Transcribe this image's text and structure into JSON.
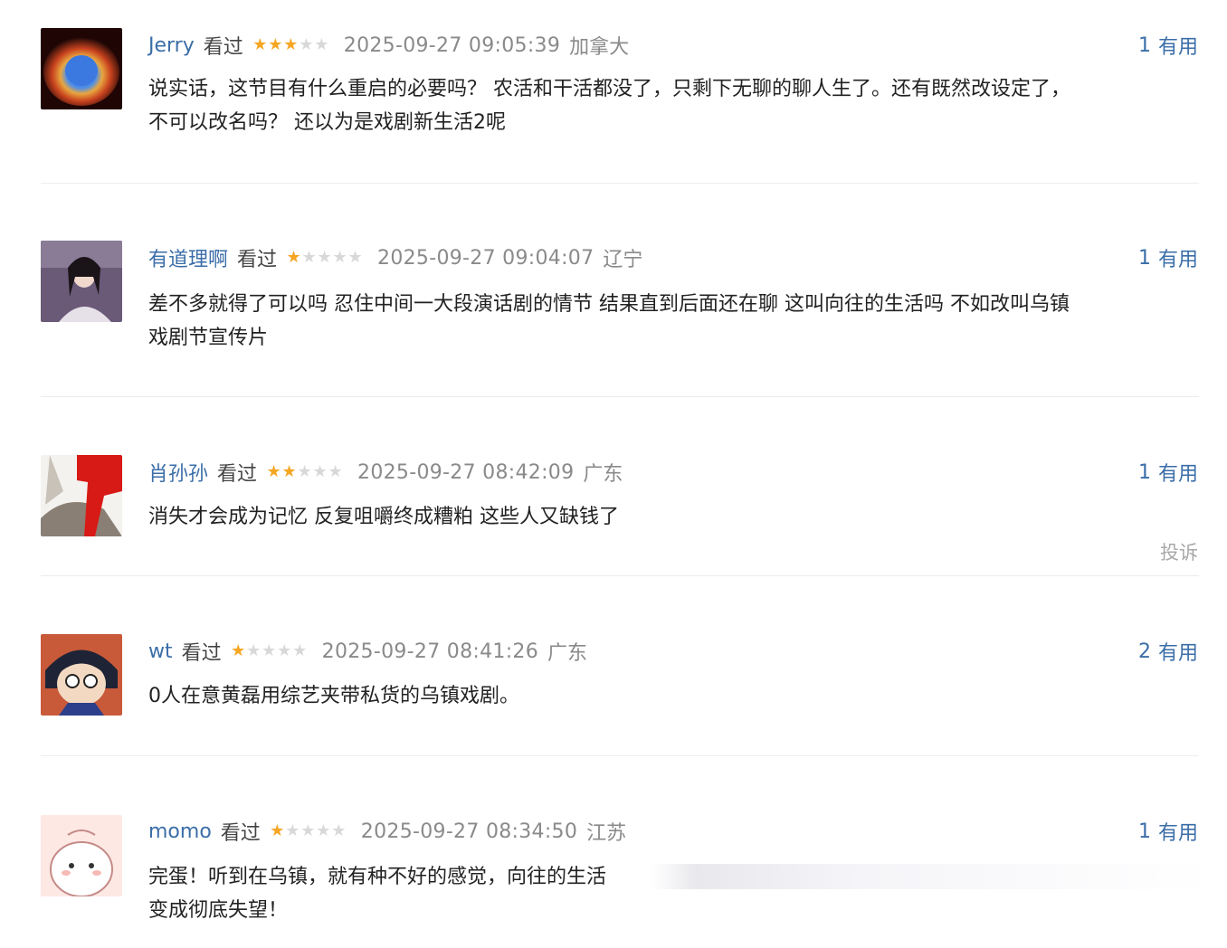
{
  "comments": [
    {
      "user": "Jerry",
      "status": "看过",
      "stars": 3,
      "time": "2025-09-27 09:05:39",
      "location": "加拿大",
      "useful_count": "1",
      "useful_label": "有用",
      "lines": [
        "说实话，这节目有什么重启的必要吗？ 农活和干活都没了，只剩下无聊的聊人生了。还有既然改设定了，",
        "不可以改名吗？ 还以为是戏剧新生活2呢"
      ]
    },
    {
      "user": "有道理啊",
      "status": "看过",
      "stars": 1,
      "time": "2025-09-27 09:04:07",
      "location": "辽宁",
      "useful_count": "1",
      "useful_label": "有用",
      "lines": [
        "差不多就得了可以吗 忍住中间一大段演话剧的情节 结果直到后面还在聊 这叫向往的生活吗 不如改叫乌镇",
        "戏剧节宣传片"
      ]
    },
    {
      "user": "肖孙孙",
      "status": "看过",
      "stars": 2,
      "time": "2025-09-27 08:42:09",
      "location": "广东",
      "useful_count": "1",
      "useful_label": "有用",
      "lines": [
        "消失才会成为记忆 反复咀嚼终成糟粕 这些人又缺钱了"
      ],
      "report_label": "投诉"
    },
    {
      "user": "wt",
      "status": "看过",
      "stars": 1,
      "time": "2025-09-27 08:41:26",
      "location": "广东",
      "useful_count": "2",
      "useful_label": "有用",
      "lines": [
        "0人在意黄磊用综艺夹带私货的乌镇戏剧。"
      ]
    },
    {
      "user": "momo",
      "status": "看过",
      "stars": 1,
      "time": "2025-09-27 08:34:50",
      "location": "江苏",
      "useful_count": "1",
      "useful_label": "有用",
      "lines": [
        "完蛋！听到在乌镇，就有种不好的感觉，向往的生活",
        "变成彻底失望！"
      ]
    }
  ],
  "colors": {
    "username": "#3b6ea8",
    "star_on": "#f5a623",
    "star_off": "#d8d8d8",
    "meta_gray": "#8a8a8a",
    "divider": "#ececec"
  },
  "star_icon": "star-icon"
}
